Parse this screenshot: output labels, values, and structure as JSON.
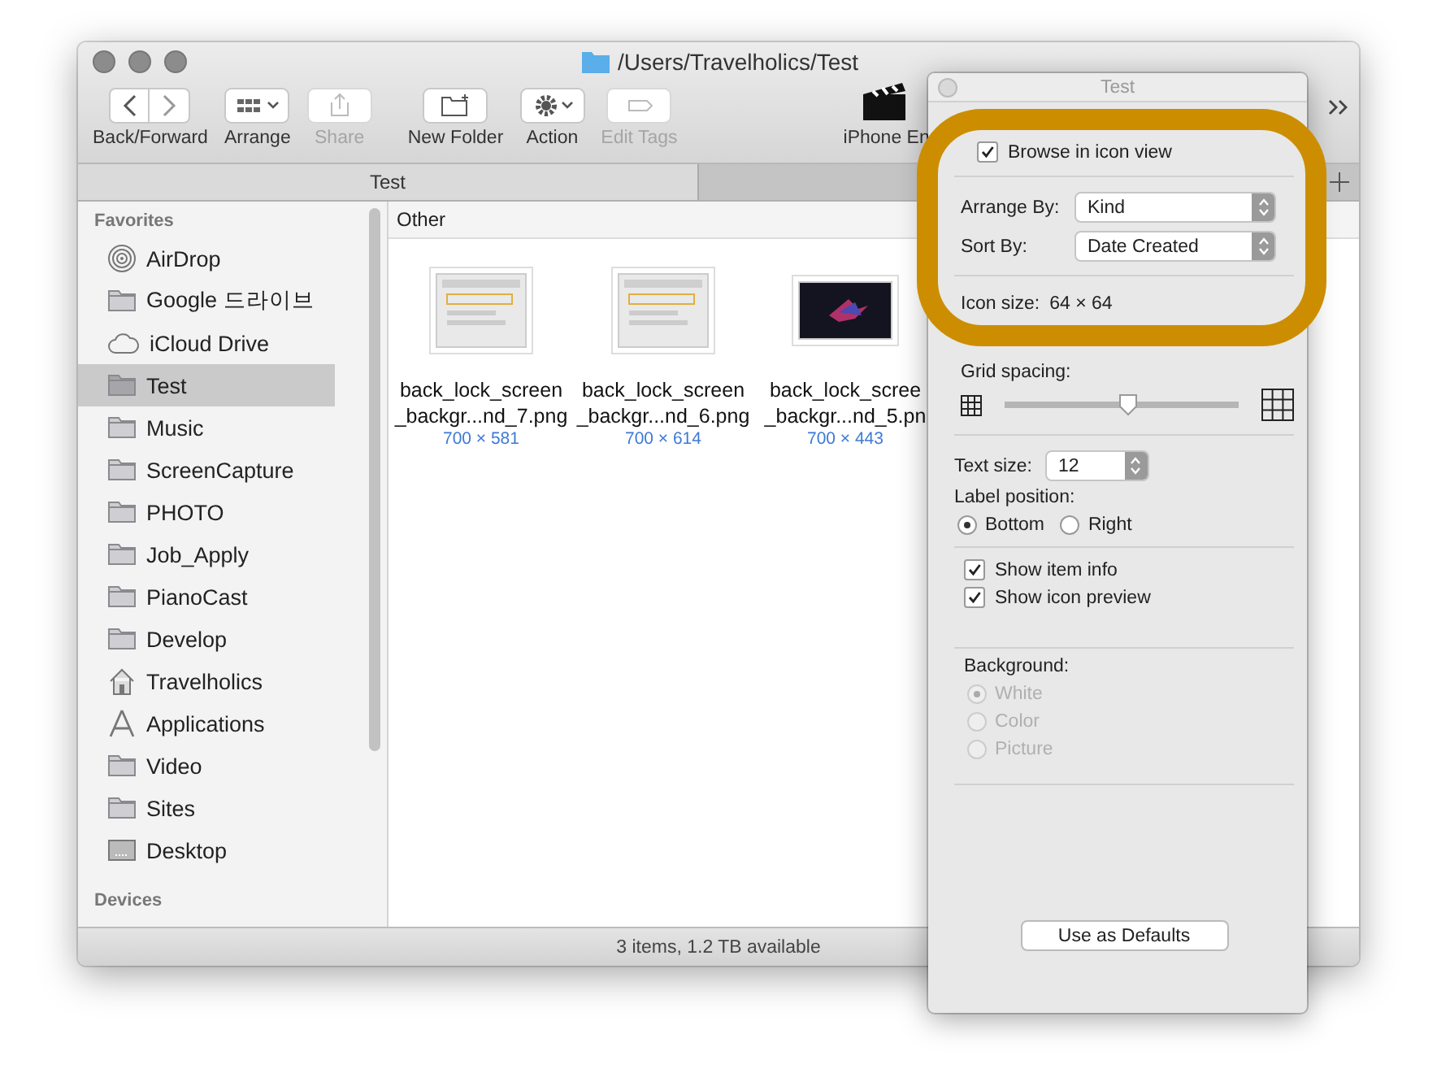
{
  "window": {
    "title": "/Users/Travelholics/Test"
  },
  "toolbar": [
    {
      "kind": "nav",
      "label": "Back/Forward",
      "disabled": false
    },
    {
      "kind": "arrange",
      "label": "Arrange",
      "disabled": false
    },
    {
      "kind": "share",
      "label": "Share",
      "disabled": true
    },
    {
      "kind": "new-folder",
      "label": "New Folder",
      "disabled": false
    },
    {
      "kind": "action",
      "label": "Action",
      "disabled": false
    },
    {
      "kind": "tags",
      "label": "Edit Tags",
      "disabled": true
    },
    {
      "kind": "app",
      "label": "iPhone En",
      "disabled": false
    }
  ],
  "tabs": [
    {
      "label": "Test",
      "selected": true
    }
  ],
  "sidebar": {
    "sections": [
      {
        "title": "Favorites",
        "items": [
          {
            "kind": "airdrop",
            "label": "AirDrop",
            "selected": false
          },
          {
            "kind": "folder",
            "label": "Google 드라이브",
            "selected": false
          },
          {
            "kind": "cloud",
            "label": "iCloud Drive",
            "selected": false
          },
          {
            "kind": "folder",
            "label": "Test",
            "selected": true
          },
          {
            "kind": "folder",
            "label": "Music",
            "selected": false
          },
          {
            "kind": "folder",
            "label": "ScreenCapture",
            "selected": false
          },
          {
            "kind": "folder",
            "label": "PHOTO",
            "selected": false
          },
          {
            "kind": "folder",
            "label": "Job_Apply",
            "selected": false
          },
          {
            "kind": "folder",
            "label": "PianoCast",
            "selected": false
          },
          {
            "kind": "folder",
            "label": "Develop",
            "selected": false
          },
          {
            "kind": "home",
            "label": "Travelholics",
            "selected": false
          },
          {
            "kind": "apps",
            "label": "Applications",
            "selected": false
          },
          {
            "kind": "folder",
            "label": "Video",
            "selected": false
          },
          {
            "kind": "folder",
            "label": "Sites",
            "selected": false
          },
          {
            "kind": "desktop",
            "label": "Desktop",
            "selected": false
          }
        ]
      },
      {
        "title": "Devices"
      }
    ]
  },
  "content": {
    "group": "Other",
    "files": [
      {
        "kind": "screenshot",
        "lines": [
          "back_lock_screen",
          "_backgr...nd_7.png"
        ],
        "dimensions": "700 × 581"
      },
      {
        "kind": "screenshot",
        "lines": [
          "back_lock_screen",
          "_backgr...nd_6.png"
        ],
        "dimensions": "700 × 614"
      },
      {
        "kind": "dark-image",
        "lines": [
          "back_lock_scree",
          "_backgr...nd_5.pn"
        ],
        "dimensions": "700 × 443"
      }
    ]
  },
  "status_bar": "3 items, 1.2 TB available",
  "view_options": {
    "title": "Test",
    "browse_in_icon_view": {
      "label": "Browse in icon view",
      "checked": true
    },
    "arrange_by": {
      "label": "Arrange By:",
      "value": "Kind"
    },
    "sort_by": {
      "label": "Sort By:",
      "value": "Date Created"
    },
    "icon_size": {
      "label": "Icon size:",
      "value": "64 × 64"
    },
    "grid_spacing": {
      "label": "Grid spacing:",
      "level": 0.53
    },
    "text_size": {
      "label": "Text size:",
      "value": "12"
    },
    "label_position": {
      "label": "Label position:",
      "options": [
        {
          "label": "Bottom",
          "selected": true
        },
        {
          "label": "Right",
          "selected": false
        }
      ]
    },
    "show_options": [
      {
        "label": "Show item info",
        "checked": true
      },
      {
        "label": "Show icon preview",
        "checked": true
      }
    ],
    "background": {
      "label": "Background:",
      "options": [
        {
          "label": "White",
          "selected": true,
          "disabled": true
        },
        {
          "label": "Color",
          "selected": false,
          "disabled": true
        },
        {
          "label": "Picture",
          "selected": false,
          "disabled": true
        }
      ]
    },
    "defaults_button": "Use as Defaults"
  }
}
